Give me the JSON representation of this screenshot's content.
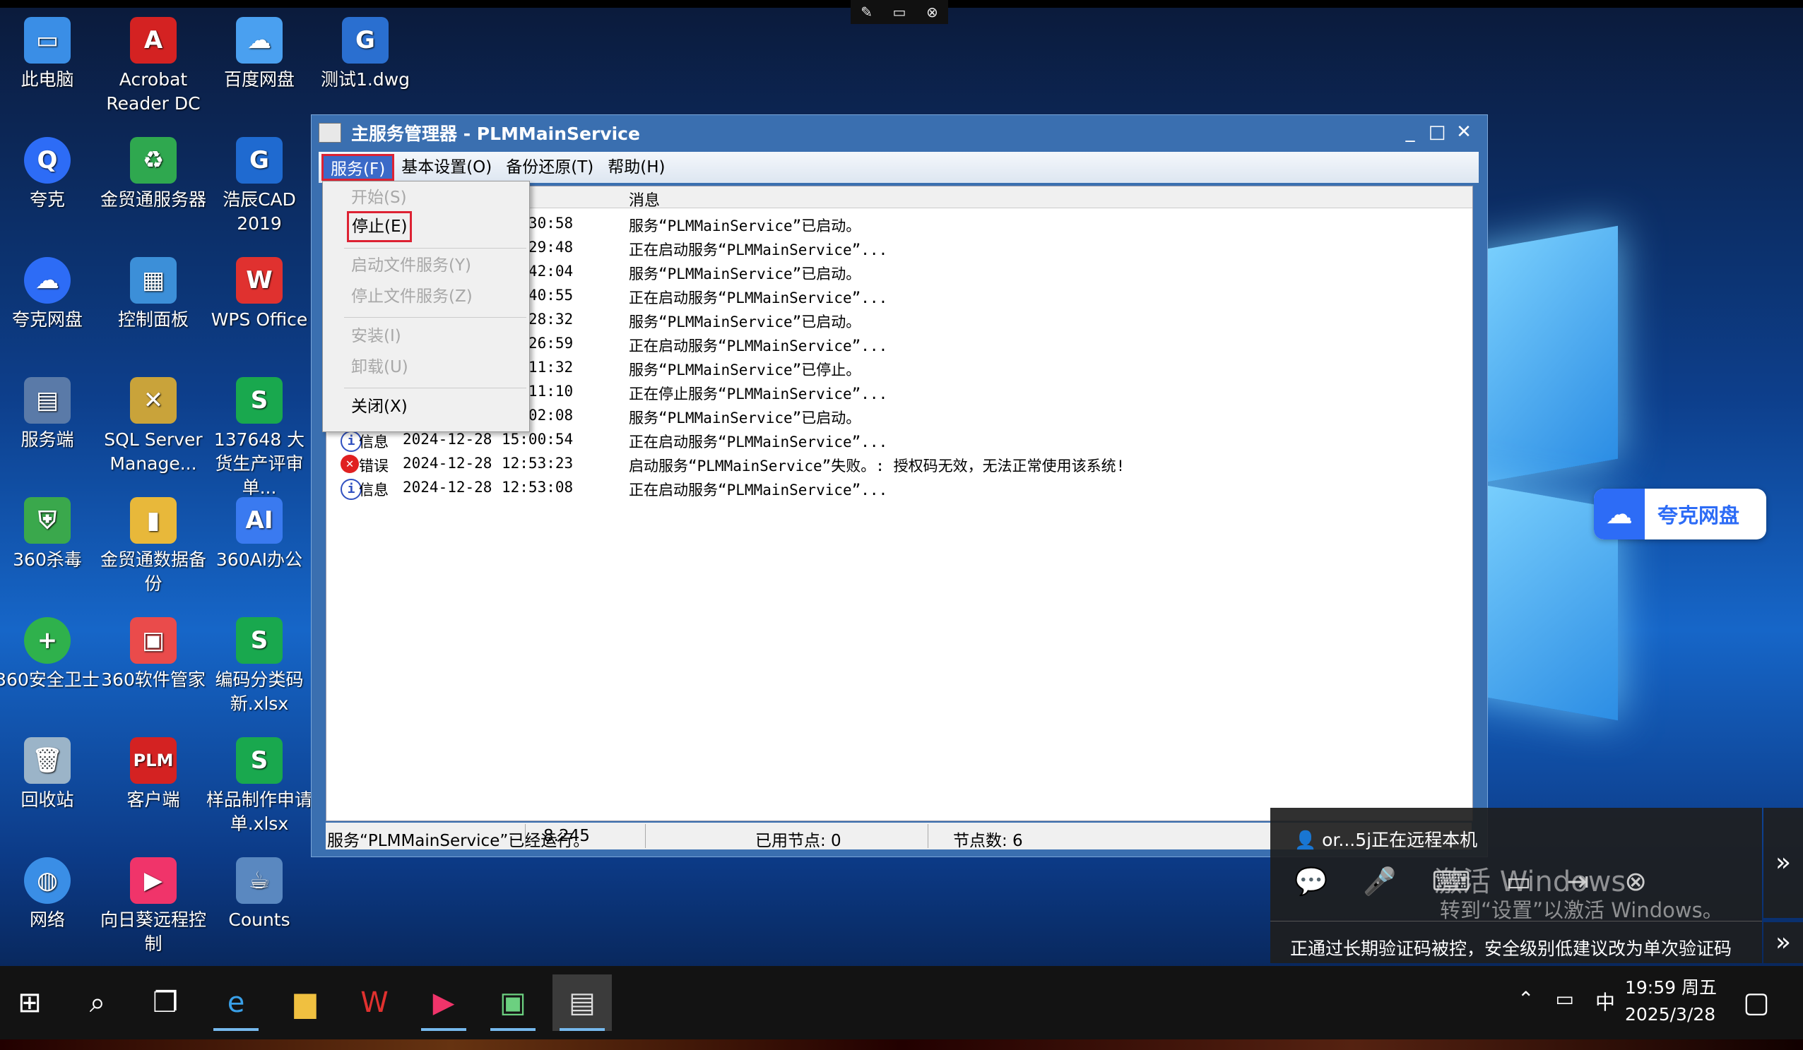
{
  "remote_control_bar": {
    "icons": [
      "pin-icon",
      "screen-icon",
      "close-icon"
    ]
  },
  "desktop_icons": [
    {
      "label": "此电脑",
      "icon": "computer-icon",
      "color": "#3a8ee6"
    },
    {
      "label": "Acrobat Reader DC",
      "icon": "acrobat-icon",
      "color": "#d42222"
    },
    {
      "label": "百度网盘",
      "icon": "baidu-netdisk-icon",
      "color": "#4aa0f0"
    },
    {
      "label": "测试1.dwg",
      "icon": "dwg-file-icon",
      "color": "#2a6fd0"
    },
    {
      "label": "夸克",
      "icon": "quark-icon",
      "color": "#2d6cf6"
    },
    {
      "label": "金贸通服务器",
      "icon": "recycle-server-icon",
      "color": "#2fa84f"
    },
    {
      "label": "浩辰CAD 2019",
      "icon": "gstarcad-icon",
      "color": "#1f6ad0"
    },
    {
      "label": "夸克网盘",
      "icon": "quark-netdisk-icon",
      "color": "#2d6cf6"
    },
    {
      "label": "控制面板",
      "icon": "control-panel-icon",
      "color": "#3c8fd8"
    },
    {
      "label": "WPS Office",
      "icon": "wps-icon",
      "color": "#e0312f"
    },
    {
      "label": "服务端",
      "icon": "server-icon",
      "color": "#5a7aa8"
    },
    {
      "label": "SQL Server Manage...",
      "icon": "sql-server-icon",
      "color": "#c9a33a"
    },
    {
      "label": "137648 大货生产评审单...",
      "icon": "spreadsheet-icon",
      "color": "#19a84e"
    },
    {
      "label": "360杀毒",
      "icon": "360-antivirus-icon",
      "color": "#3aa84c"
    },
    {
      "label": "金贸通数据备份",
      "icon": "backup-icon",
      "color": "#e8b83a"
    },
    {
      "label": "360AI办公",
      "icon": "360-ai-office-icon",
      "color": "#3a7af0"
    },
    {
      "label": "360安全卫士",
      "icon": "360-safeguard-icon",
      "color": "#2fb14c"
    },
    {
      "label": "360软件管家",
      "icon": "360-software-manager-icon",
      "color": "#ea4b4b"
    },
    {
      "label": "编码分类码新.xlsx",
      "icon": "spreadsheet-icon",
      "color": "#19a84e"
    },
    {
      "label": "回收站",
      "icon": "recycle-bin-icon",
      "color": "#9bb4c8"
    },
    {
      "label": "客户端",
      "icon": "plm-client-icon",
      "color": "#d42222"
    },
    {
      "label": "样品制作申请单.xlsx",
      "icon": "spreadsheet-icon",
      "color": "#19a84e"
    },
    {
      "label": "网络",
      "icon": "network-icon",
      "color": "#3a8ee6"
    },
    {
      "label": "向日葵远程控制",
      "icon": "sunlogin-icon",
      "color": "#f0346a"
    },
    {
      "label": "Counts",
      "icon": "java-icon",
      "color": "#5a88c0"
    }
  ],
  "window": {
    "title": "主服务管理器 - PLMMainService",
    "menu": [
      "服务(F)",
      "基本设置(O)",
      "备份还原(T)",
      "帮助(H)"
    ],
    "column_message": "消息",
    "log": [
      {
        "type": "",
        "date": "",
        "time": "23:30:58",
        "message": "服务“PLMMainService”已启动。"
      },
      {
        "type": "",
        "date": "",
        "time": "23:29:48",
        "message": "正在启动服务“PLMMainService”..."
      },
      {
        "type": "",
        "date": "",
        "time": "14:42:04",
        "message": "服务“PLMMainService”已启动。"
      },
      {
        "type": "",
        "date": "",
        "time": "14:40:55",
        "message": "正在启动服务“PLMMainService”..."
      },
      {
        "type": "",
        "date": "",
        "time": "13:28:32",
        "message": "服务“PLMMainService”已启动。"
      },
      {
        "type": "",
        "date": "",
        "time": "13:26:59",
        "message": "正在启动服务“PLMMainService”..."
      },
      {
        "type": "",
        "date": "",
        "time": "13:11:32",
        "message": "服务“PLMMainService”已停止。"
      },
      {
        "type": "",
        "date": "",
        "time": "13:11:10",
        "message": "正在停止服务“PLMMainService”..."
      },
      {
        "type": "",
        "date": "",
        "time": "15:02:08",
        "message": "服务“PLMMainService”已启动。"
      },
      {
        "type": "信息",
        "date": "2024-12-28",
        "time": "15:00:54",
        "message": "正在启动服务“PLMMainService”..."
      },
      {
        "type": "错误",
        "date": "2024-12-28",
        "time": "12:53:23",
        "message": "启动服务“PLMMainService”失败。: 授权码无效，无法正常使用该系统!"
      },
      {
        "type": "信息",
        "date": "2024-12-28",
        "time": "12:53:08",
        "message": "正在启动服务“PLMMainService”..."
      }
    ],
    "status": {
      "text": "服务“PLMMainService”已经运行。",
      "version": "8.245",
      "used_nodes": "已用节点: 0",
      "node_count": "节点数: 6"
    }
  },
  "dropdown": [
    {
      "label": "开始(S)",
      "enabled": false
    },
    {
      "label": "停止(E)",
      "enabled": true
    },
    {
      "label": "启动文件服务(Y)",
      "enabled": false
    },
    {
      "label": "停止文件服务(Z)",
      "enabled": false
    },
    {
      "label": "安装(I)",
      "enabled": false
    },
    {
      "label": "卸载(U)",
      "enabled": false
    },
    {
      "label": "关闭(X)",
      "enabled": true
    }
  ],
  "quark_float": {
    "label": "夸克网盘"
  },
  "remote_panel": {
    "user": "or...5j正在远程本机",
    "watermark_title": "激活 Windows",
    "watermark_sub": "转到“设置”以激活 Windows。",
    "notice": "正通过长期验证码被控，安全级别低建议改为单次验证码"
  },
  "taskbar": {
    "time": "19:59 周五",
    "date": "2025/3/28",
    "ime": "中"
  },
  "colors": {
    "accent": "#3a6fb0",
    "error": "#e02020",
    "highlight": "#d22"
  }
}
